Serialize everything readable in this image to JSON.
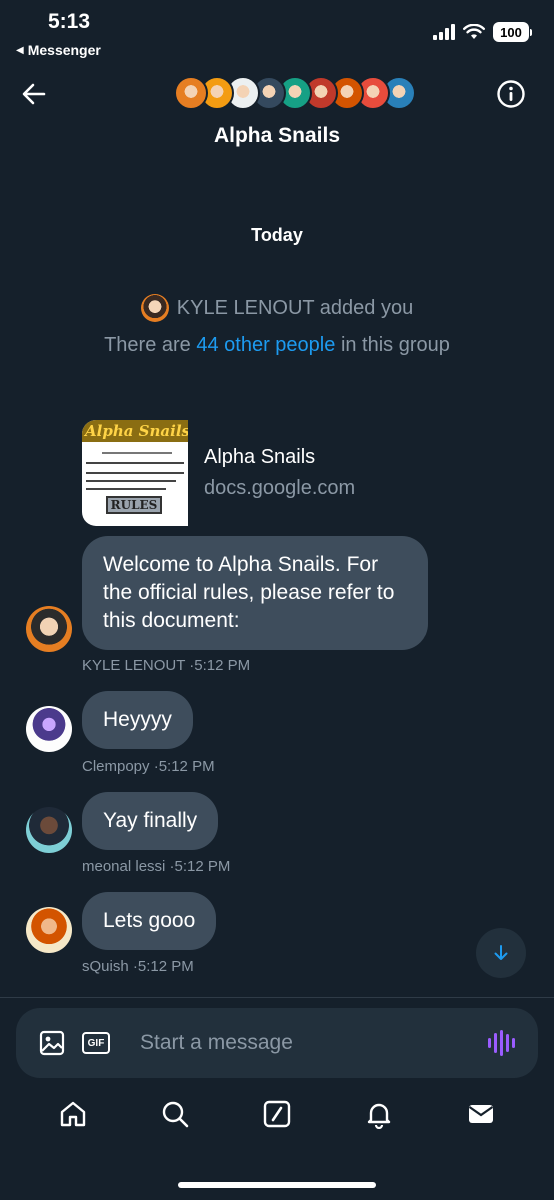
{
  "status": {
    "time": "5:13",
    "back_app": "Messenger",
    "battery": "100"
  },
  "header": {
    "title": "Alpha Snails",
    "avatar_colors": [
      "#e67e22",
      "#f39c12",
      "#ecf0f1",
      "#34495e",
      "#16a085",
      "#c0392b",
      "#d35400",
      "#e74c3c",
      "#2980b9"
    ]
  },
  "timeline": {
    "date_label": "Today",
    "added_text": "KYLE LENOUT added you",
    "others_prefix": "There are",
    "others_link": "44 other people",
    "others_suffix": "in this group"
  },
  "link_card": {
    "thumb_banner": "Alpha Snails",
    "thumb_rules": "RULES",
    "title": "Alpha Snails",
    "domain": "docs.google.com"
  },
  "messages": [
    {
      "text": "Welcome to Alpha Snails. For the official rules, please refer to this document:",
      "author": "KYLE LENOUT",
      "time": "5:12 PM"
    },
    {
      "text": "Heyyyy",
      "author": "Clempopy",
      "time": "5:12 PM"
    },
    {
      "text": "Yay finally",
      "author": "meonal lessi",
      "time": "5:12 PM"
    },
    {
      "text": "Lets gooo",
      "author": "sQuish",
      "time": "5:12 PM"
    }
  ],
  "composer": {
    "placeholder": "Start a message",
    "gif_label": "GIF"
  },
  "icons": {
    "back": "arrow-left-icon",
    "info": "info-circle-icon",
    "image": "image-icon",
    "gif": "gif-icon",
    "voice": "voice-wave-icon",
    "scroll": "arrow-down-icon",
    "tabs": [
      "home-icon",
      "search-icon",
      "grok-icon",
      "notifications-icon",
      "messages-icon"
    ]
  }
}
